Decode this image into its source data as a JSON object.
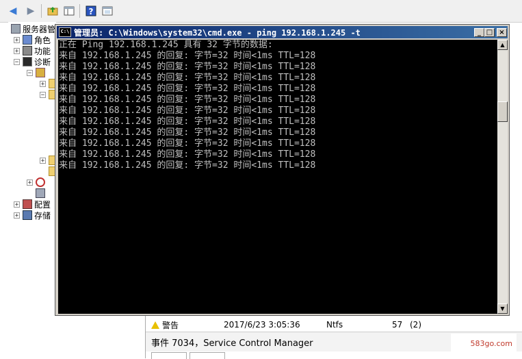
{
  "tree": {
    "items": [
      {
        "label": "服务器管",
        "expander": ""
      },
      {
        "label": "角色",
        "expander": "+"
      },
      {
        "label": "功能",
        "expander": "+"
      },
      {
        "label": "诊断",
        "expander": "−"
      },
      {
        "label": "",
        "expander": "−"
      },
      {
        "label": "",
        "expander": "+"
      },
      {
        "label": "",
        "expander": "−"
      },
      {
        "label": "",
        "expander": "+"
      },
      {
        "label": "",
        "expander": ""
      },
      {
        "label": "",
        "expander": "+"
      },
      {
        "label": "",
        "expander": ""
      },
      {
        "label": "配置",
        "expander": "+"
      },
      {
        "label": "存储",
        "expander": "+"
      }
    ]
  },
  "cmd": {
    "title": "管理员: C:\\Windows\\system32\\cmd.exe - ping  192.168.1.245 -t",
    "icon_text": "C:\\",
    "lines": [
      "正在 Ping 192.168.1.245 具有 32 字节的数据:",
      "来自 192.168.1.245 的回复: 字节=32 时间<1ms TTL=128",
      "来自 192.168.1.245 的回复: 字节=32 时间<1ms TTL=128",
      "来自 192.168.1.245 的回复: 字节=32 时间<1ms TTL=128",
      "来自 192.168.1.245 的回复: 字节=32 时间<1ms TTL=128",
      "来自 192.168.1.245 的回复: 字节=32 时间<1ms TTL=128",
      "来自 192.168.1.245 的回复: 字节=32 时间<1ms TTL=128",
      "来自 192.168.1.245 的回复: 字节=32 时间<1ms TTL=128",
      "来自 192.168.1.245 的回复: 字节=32 时间<1ms TTL=128",
      "来自 192.168.1.245 的回复: 字节=32 时间<1ms TTL=128",
      "来自 192.168.1.245 的回复: 字节=32 时间<1ms TTL=128",
      "来自 192.168.1.245 的回复: 字节=32 时间<1ms TTL=128"
    ],
    "minimize_glyph": "_",
    "maximize_glyph": "□",
    "close_glyph": "×"
  },
  "log_row": {
    "level": "警告",
    "datetime": "2017/6/23 3:05:36",
    "source": "Ntfs",
    "event_id": "57",
    "category": "(2)"
  },
  "event_bar": {
    "text": "事件 7034，Service Control Manager"
  },
  "watermark": {
    "text": "583go.com"
  },
  "colors": {
    "title_bar": "#0a246a",
    "console_bg": "#000000",
    "console_fg": "#c0c0c0"
  }
}
